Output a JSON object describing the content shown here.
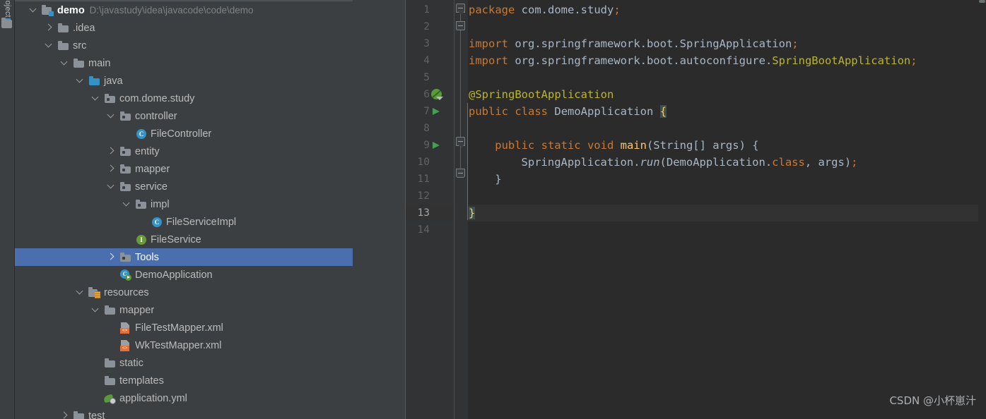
{
  "toolwindow": {
    "tab_label": "Project",
    "folder_icon": "folder-icon"
  },
  "project_tree": {
    "selected_index": 14,
    "rows": [
      {
        "indent": 0,
        "twisty": "open",
        "icon": "module-icon",
        "label": "demo",
        "bold": true,
        "path": "D:\\javastudy\\idea\\javacode\\code\\demo"
      },
      {
        "indent": 1,
        "twisty": "closed",
        "icon": "folder-icon",
        "label": ".idea",
        "bold": false,
        "path": ""
      },
      {
        "indent": 1,
        "twisty": "open",
        "icon": "folder-icon",
        "label": "src",
        "bold": false,
        "path": ""
      },
      {
        "indent": 2,
        "twisty": "open",
        "icon": "folder-icon",
        "label": "main",
        "bold": false,
        "path": ""
      },
      {
        "indent": 3,
        "twisty": "open",
        "icon": "folder-blue-icon",
        "label": "java",
        "bold": false,
        "path": ""
      },
      {
        "indent": 4,
        "twisty": "open",
        "icon": "package-icon",
        "label": "com.dome.study",
        "bold": false,
        "path": ""
      },
      {
        "indent": 5,
        "twisty": "open",
        "icon": "package-icon",
        "label": "controller",
        "bold": false,
        "path": ""
      },
      {
        "indent": 6,
        "twisty": "none",
        "icon": "class-icon",
        "label": "FileController",
        "bold": false,
        "path": ""
      },
      {
        "indent": 5,
        "twisty": "closed",
        "icon": "package-icon",
        "label": "entity",
        "bold": false,
        "path": ""
      },
      {
        "indent": 5,
        "twisty": "closed",
        "icon": "package-icon",
        "label": "mapper",
        "bold": false,
        "path": ""
      },
      {
        "indent": 5,
        "twisty": "open",
        "icon": "package-icon",
        "label": "service",
        "bold": false,
        "path": ""
      },
      {
        "indent": 6,
        "twisty": "open",
        "icon": "package-icon",
        "label": "impl",
        "bold": false,
        "path": ""
      },
      {
        "indent": 7,
        "twisty": "none",
        "icon": "class-icon",
        "label": "FileServiceImpl",
        "bold": false,
        "path": ""
      },
      {
        "indent": 6,
        "twisty": "none",
        "icon": "interface-icon",
        "label": "FileService",
        "bold": false,
        "path": ""
      },
      {
        "indent": 5,
        "twisty": "closed",
        "icon": "package-icon",
        "label": "Tools",
        "bold": false,
        "path": ""
      },
      {
        "indent": 5,
        "twisty": "none",
        "icon": "spring-class-icon",
        "label": "DemoApplication",
        "bold": false,
        "path": ""
      },
      {
        "indent": 3,
        "twisty": "open",
        "icon": "resources-icon",
        "label": "resources",
        "bold": false,
        "path": ""
      },
      {
        "indent": 4,
        "twisty": "open",
        "icon": "folder-icon",
        "label": "mapper",
        "bold": false,
        "path": ""
      },
      {
        "indent": 5,
        "twisty": "none",
        "icon": "xml-file-icon",
        "label": "FileTestMapper.xml",
        "bold": false,
        "path": ""
      },
      {
        "indent": 5,
        "twisty": "none",
        "icon": "xml-file-icon",
        "label": "WkTestMapper.xml",
        "bold": false,
        "path": ""
      },
      {
        "indent": 4,
        "twisty": "none",
        "icon": "folder-icon",
        "label": "static",
        "bold": false,
        "path": ""
      },
      {
        "indent": 4,
        "twisty": "none",
        "icon": "folder-icon",
        "label": "templates",
        "bold": false,
        "path": ""
      },
      {
        "indent": 4,
        "twisty": "none",
        "icon": "yml-file-icon",
        "label": "application.yml",
        "bold": false,
        "path": ""
      },
      {
        "indent": 2,
        "twisty": "closed",
        "icon": "folder-icon",
        "label": "test",
        "bold": false,
        "path": ""
      }
    ]
  },
  "editor": {
    "current_line": 13,
    "line_numbers": [
      1,
      2,
      3,
      4,
      5,
      6,
      7,
      8,
      9,
      10,
      11,
      12,
      13,
      14
    ],
    "gutter_markers": [
      {
        "line": 6,
        "icon": "spring-bean-icon"
      },
      {
        "line": 7,
        "icon": "run-arrow-icon"
      },
      {
        "line": 9,
        "icon": "run-arrow-icon"
      }
    ],
    "lines": [
      {
        "n": 1,
        "indent": 0,
        "tokens": [
          {
            "t": "package",
            "c": "kw"
          },
          {
            "t": " ",
            "c": "plain"
          },
          {
            "t": "com.dome.study",
            "c": "ident"
          },
          {
            "t": ";",
            "c": "semi"
          }
        ]
      },
      {
        "n": 2,
        "indent": 0,
        "tokens": []
      },
      {
        "n": 3,
        "indent": 0,
        "tokens": [
          {
            "t": "import",
            "c": "kw"
          },
          {
            "t": " ",
            "c": "plain"
          },
          {
            "t": "org.springframework.boot.",
            "c": "ident"
          },
          {
            "t": "SpringApplication",
            "c": "ident"
          },
          {
            "t": ";",
            "c": "semi"
          }
        ]
      },
      {
        "n": 4,
        "indent": 0,
        "tokens": [
          {
            "t": "import",
            "c": "kw"
          },
          {
            "t": " ",
            "c": "plain"
          },
          {
            "t": "org.springframework.boot.autoconfigure.",
            "c": "ident"
          },
          {
            "t": "SpringBootApplication",
            "c": "anno"
          },
          {
            "t": ";",
            "c": "semi"
          }
        ]
      },
      {
        "n": 5,
        "indent": 0,
        "tokens": []
      },
      {
        "n": 6,
        "indent": 0,
        "tokens": [
          {
            "t": "@SpringBootApplication",
            "c": "anno"
          }
        ]
      },
      {
        "n": 7,
        "indent": 0,
        "tokens": [
          {
            "t": "public",
            "c": "kw"
          },
          {
            "t": " ",
            "c": "plain"
          },
          {
            "t": "class",
            "c": "kw"
          },
          {
            "t": " ",
            "c": "plain"
          },
          {
            "t": "DemoApplication",
            "c": "cname"
          },
          {
            "t": " ",
            "c": "plain"
          },
          {
            "t": "{",
            "c": "brace-hl"
          }
        ]
      },
      {
        "n": 8,
        "indent": 0,
        "tokens": []
      },
      {
        "n": 9,
        "indent": 4,
        "tokens": [
          {
            "t": "public",
            "c": "kw"
          },
          {
            "t": " ",
            "c": "plain"
          },
          {
            "t": "static",
            "c": "kw"
          },
          {
            "t": " ",
            "c": "plain"
          },
          {
            "t": "void",
            "c": "kw"
          },
          {
            "t": " ",
            "c": "plain"
          },
          {
            "t": "main",
            "c": "method"
          },
          {
            "t": "(String[] args) {",
            "c": "ident"
          }
        ]
      },
      {
        "n": 10,
        "indent": 8,
        "tokens": [
          {
            "t": "SpringApplication",
            "c": "ident"
          },
          {
            "t": ".",
            "c": "ident"
          },
          {
            "t": "run",
            "c": "italic-ident"
          },
          {
            "t": "(DemoApplication.",
            "c": "ident"
          },
          {
            "t": "class",
            "c": "kw"
          },
          {
            "t": ", args)",
            "c": "ident"
          },
          {
            "t": ";",
            "c": "semi"
          }
        ]
      },
      {
        "n": 11,
        "indent": 4,
        "tokens": [
          {
            "t": "}",
            "c": "ident"
          }
        ]
      },
      {
        "n": 12,
        "indent": 0,
        "tokens": []
      },
      {
        "n": 13,
        "indent": 0,
        "tokens": [
          {
            "t": "}",
            "c": "brace-hl"
          }
        ]
      },
      {
        "n": 14,
        "indent": 0,
        "tokens": []
      }
    ]
  },
  "watermark": {
    "text": "CSDN @小杯崽汁"
  },
  "colors": {
    "tree_bg": "#3c3f41",
    "editor_bg": "#2b2b2b",
    "gutter_bg": "#313335",
    "selection_blue": "#4b6eaf",
    "keyword_orange": "#cc7832",
    "annotation_yellow": "#bbb529",
    "method_yellow": "#ffc66d",
    "text_grey": "#a9b7c6",
    "run_green": "#499c54"
  }
}
